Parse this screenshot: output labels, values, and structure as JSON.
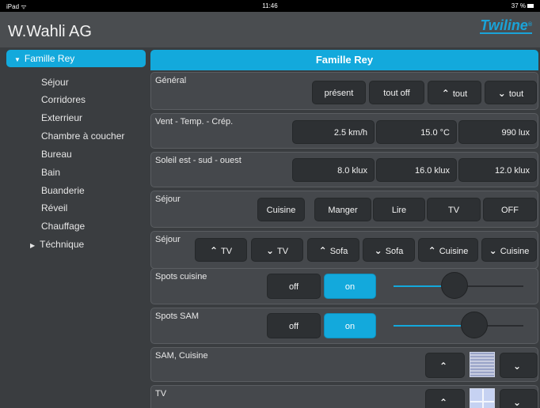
{
  "status_bar": {
    "carrier": "iPad ᯤ",
    "time": "11:46",
    "battery": "37 %"
  },
  "header": {
    "title": "W.Wahli AG",
    "logo": "Twiline",
    "logo_mark": "®"
  },
  "sidebar": {
    "selected": "Famille Rey",
    "items": [
      "Séjour",
      "Corridores",
      "Exterrieur",
      "Chambre à coucher",
      "Bureau",
      "Bain",
      "Buanderie",
      "Réveil",
      "Chauffage"
    ],
    "collapsed_group": "Téchnique"
  },
  "main": {
    "title": "Famille Rey",
    "general": {
      "label": "Général",
      "buttons": [
        "présent",
        "tout off",
        "tout",
        "tout"
      ]
    },
    "wind": {
      "label": "Vent - Temp. - Crép.",
      "values": [
        "2.5 km/h",
        "15.0 °C",
        "990 lux"
      ]
    },
    "sun": {
      "label": "Soleil est - sud - ouest",
      "values": [
        "8.0 klux",
        "16.0 klux",
        "12.0 klux"
      ]
    },
    "scenes": {
      "label": "Séjour",
      "buttons": [
        "Cuisine",
        "Manger",
        "Lire",
        "TV",
        "OFF"
      ]
    },
    "blinds": {
      "label": "Séjour",
      "buttons": [
        "TV",
        "TV",
        "Sofa",
        "Sofa",
        "Cuisine",
        "Cuisine"
      ]
    },
    "spots_cuisine": {
      "label": "Spots cuisine",
      "off": "off",
      "on": "on",
      "level": 0.47
    },
    "spots_sam": {
      "label": "Spots SAM",
      "off": "off",
      "on": "on",
      "level": 0.62
    },
    "sam_cuisine": {
      "label": "SAM, Cuisine"
    },
    "tv": {
      "label": "TV"
    }
  },
  "colors": {
    "accent": "#13a9dc",
    "background": "#3a3d40",
    "button": "#2d3033"
  },
  "icons": {
    "up": "chevron-up-icon",
    "down": "chevron-down-icon",
    "expand": "triangle-down-icon",
    "collapse": "triangle-right-icon"
  }
}
